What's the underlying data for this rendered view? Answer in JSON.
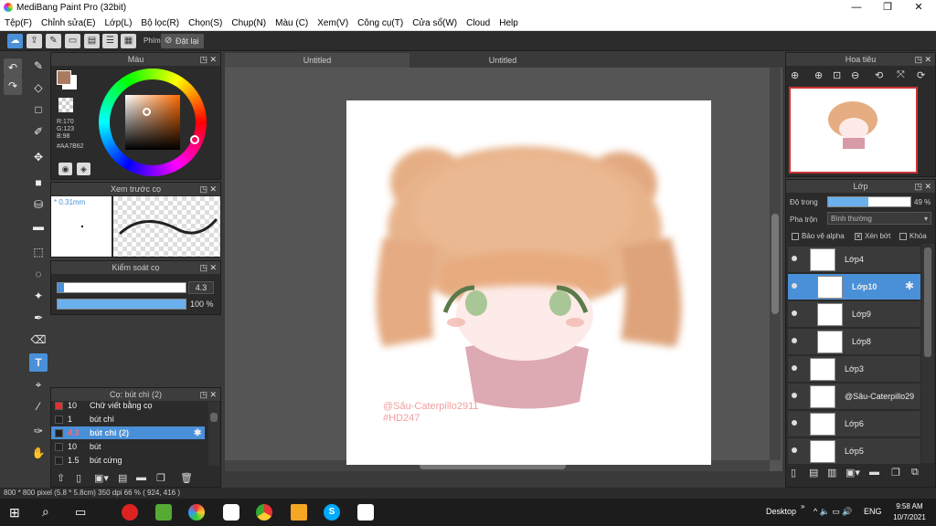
{
  "window": {
    "title": "MediBang Paint Pro (32bit)",
    "min": "—",
    "max": "❐",
    "close": "✕"
  },
  "menu": [
    "Tệp(F)",
    "Chỉnh sửa(E)",
    "Lớp(L)",
    "Bộ lọc(R)",
    "Chọn(S)",
    "Chụp(N)",
    "Màu (C)",
    "Xem(V)",
    "Công cụ(T)",
    "Cửa sổ(W)",
    "Cloud",
    "Help"
  ],
  "toolbar": {
    "shortcut_label": "Phím",
    "reset_label": "Đặt lại"
  },
  "tabs": [
    "Untitled",
    "Untitled"
  ],
  "color_panel": {
    "title": "Màu",
    "r": "R:170",
    "g": "G:123",
    "b": "B:98",
    "hex": "#AA7B62",
    "fg": "#aa7b62",
    "bg": "#ffffff"
  },
  "brush_preview": {
    "title": "Xem trước cọ",
    "size": "* 0.31mm"
  },
  "brush_control": {
    "title": "Kiểm soát cọ",
    "size_value": "4.3",
    "opacity_value": "100 %",
    "size_fraction": 0.05,
    "opacity_fraction": 1.0
  },
  "brush_list": {
    "title": "Cọ: bút chì (2)",
    "items": [
      {
        "size": "10",
        "name": "Chữ viết bằng cọ",
        "color": "#e03030"
      },
      {
        "size": "1",
        "name": "bút chì",
        "color": "#222222"
      },
      {
        "size": "4.3",
        "name": "bút chì (2)",
        "color": "#222222",
        "selected": true
      },
      {
        "size": "10",
        "name": "bút",
        "color": "#222222"
      },
      {
        "size": "1.5",
        "name": "bút cứng",
        "color": "#222222"
      }
    ]
  },
  "navigator": {
    "title": "Hoa tiêu"
  },
  "layer_panel": {
    "title": "Lớp",
    "opacity_label": "Độ trong",
    "opacity_value": "49 %",
    "opacity_fraction": 0.49,
    "blend_label": "Pha trộn",
    "blend_value": "Bình thường",
    "protect_alpha": "Bảo vệ alpha",
    "clipping": "Xén bớt",
    "lock": "Khóa",
    "layers": [
      {
        "name": "Lớp4"
      },
      {
        "name": "Lớp10",
        "selected": true
      },
      {
        "name": "Lớp9"
      },
      {
        "name": "Lớp8"
      },
      {
        "name": "Lớp3"
      },
      {
        "name": "@Sâu-Caterpillo29"
      },
      {
        "name": "Lớp6"
      },
      {
        "name": "Lớp5"
      }
    ]
  },
  "canvas": {
    "watermark_line1": "@Sâu-Caterpillo2911",
    "watermark_line2": "#HD247"
  },
  "status": {
    "text": "800 * 800 pixel   (5.8 * 5.8cm)   350 dpi   66 %   ( 924, 416 )"
  },
  "taskbar": {
    "desktop": "Desktop",
    "lang": "ENG",
    "time": "9:58 AM",
    "date": "10/7/2021"
  }
}
